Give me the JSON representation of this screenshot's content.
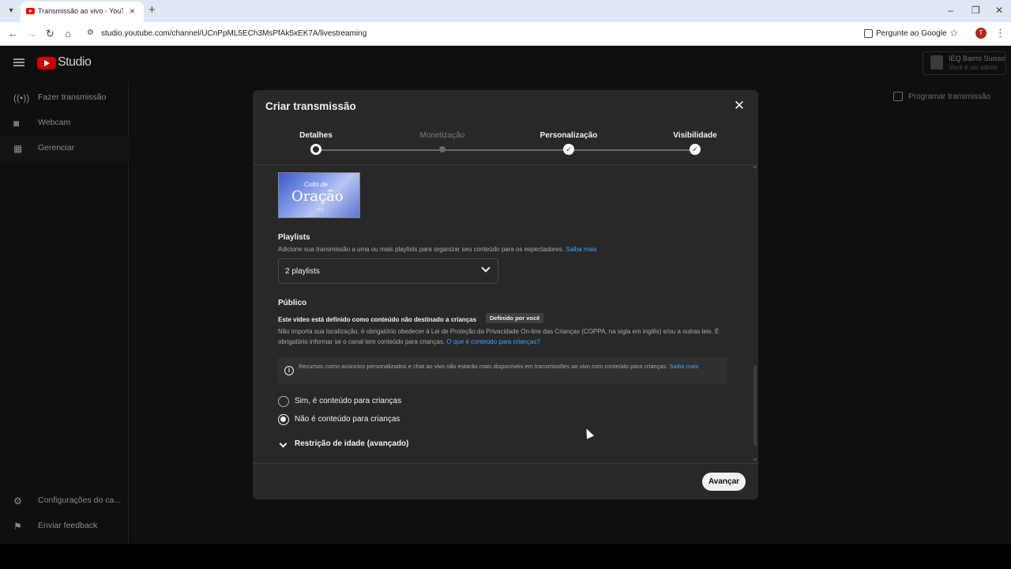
{
  "browser": {
    "tab_title": "Transmissão ao vivo - YouTube",
    "tab_list_icon": "chevron-down-icon",
    "url": "studio.youtube.com/channel/UCnPpML5ECh3MsPfAk5xEK7A/livestreaming",
    "ask_google": "Pergunte ao Google",
    "profile_initial": "T"
  },
  "studio": {
    "logo_text": "Studio",
    "channel_name": "IEQ Bairro Suisso",
    "channel_role": "Você é um admin",
    "schedule_button": "Programar transmissão"
  },
  "sidebar": {
    "items": [
      {
        "label": "Fazer transmissão",
        "icon": "broadcast-icon"
      },
      {
        "label": "Webcam",
        "icon": "camera-icon"
      },
      {
        "label": "Gerenciar",
        "icon": "calendar-icon"
      }
    ],
    "bottom_items": [
      {
        "label": "Configurações do ca...",
        "icon": "gear-icon"
      },
      {
        "label": "Enviar feedback",
        "icon": "feedback-icon"
      }
    ]
  },
  "modal": {
    "title": "Criar transmissão",
    "steps": [
      {
        "label": "Detalhes",
        "state": "current"
      },
      {
        "label": "Monetização",
        "state": "disabled"
      },
      {
        "label": "Personalização",
        "state": "done"
      },
      {
        "label": "Visibilidade",
        "state": "done"
      }
    ],
    "thumbnail": {
      "line1": "Culto de",
      "line2": "Oração",
      "line3": "IEQ"
    },
    "playlists": {
      "title": "Playlists",
      "description": "Adicione sua transmissão a uma ou mais playlists para organizar seu conteúdo para os espectadores.",
      "learn_more": "Saiba mais",
      "selected": "2 playlists"
    },
    "audience": {
      "title": "Público",
      "status_line": "Este vídeo está definido como conteúdo não destinado a crianças",
      "badge": "Definido por você",
      "description": "Não importa sua localização, é obrigatório obedecer à Lei de Proteção da Privacidade On-line das Crianças (COPPA, na sigla em inglês) e/ou a outras leis. É obrigatório informar se o canal tem conteúdo para crianças.",
      "description_link": "O que é conteúdo para crianças?",
      "info": "Recursos como anúncios personalizados e chat ao vivo não estarão mais disponíveis em transmissões ao vivo com conteúdo para crianças.",
      "info_link": "Saiba mais",
      "options": [
        {
          "label": "Sim, é conteúdo para crianças",
          "checked": false
        },
        {
          "label": "Não é conteúdo para crianças",
          "checked": true
        }
      ]
    },
    "age_restriction": "Restrição de idade (avançado)",
    "next_button": "Avançar"
  }
}
